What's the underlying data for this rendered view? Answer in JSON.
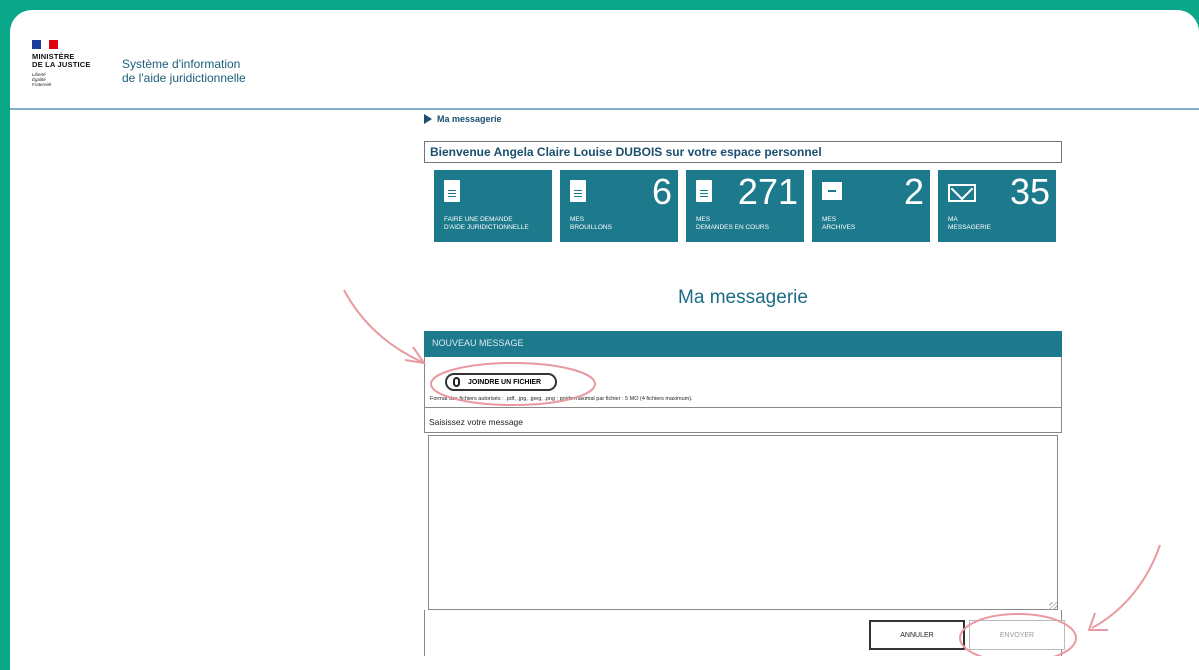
{
  "header": {
    "ministry": "MINISTÈRE\nDE LA JUSTICE",
    "motto": "Liberté\nÉgalité\nFraternité",
    "system_title": "Système d'information\nde l'aide juridictionnelle"
  },
  "breadcrumb": {
    "label": "Ma messagerie"
  },
  "welcome": "Bienvenue Angela Claire Louise DUBOIS sur votre espace personnel",
  "tiles": [
    {
      "label": "FAIRE UNE DEMANDE\nD'AIDE JURIDICTIONNELLE",
      "count": "",
      "icon": "document-icon"
    },
    {
      "label": "MES\nBROUILLONS",
      "count": "6",
      "icon": "draft-icon"
    },
    {
      "label": "MES\nDEMANDES EN COURS",
      "count": "271",
      "icon": "pending-requests-icon"
    },
    {
      "label": "MES\nARCHIVES",
      "count": "2",
      "icon": "archive-icon"
    },
    {
      "label": "MA\nMESSAGERIE",
      "count": "35",
      "icon": "mail-icon"
    }
  ],
  "page_title": "Ma messagerie",
  "compose": {
    "header": "NOUVEAU MESSAGE",
    "attach_label": "JOINDRE UN FICHIER",
    "attach_note": "Format des fichiers autorisés : .pdf, .jpg, .jpeg, .png ; poids maximal par fichier : 5 MO (4 fichiers maximum).",
    "message_label": "Saisissez votre message",
    "message_value": "",
    "cancel_label": "ANNULER",
    "send_label": "ENVOYER"
  },
  "colors": {
    "background": "#0aa888",
    "tile": "#1d7a8d",
    "annotation": "#e89aa0"
  }
}
